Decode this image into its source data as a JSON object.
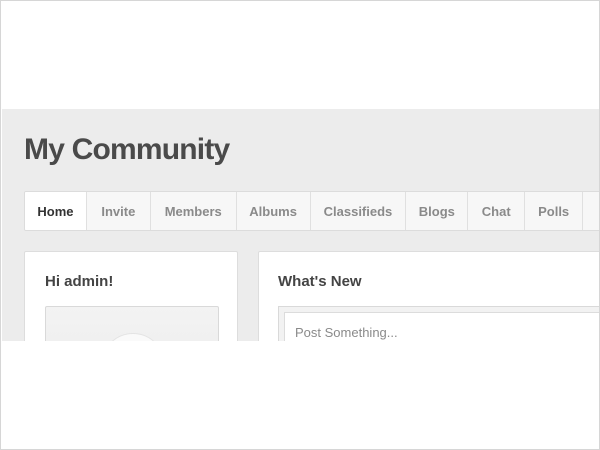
{
  "site": {
    "title": "My Community"
  },
  "nav": {
    "items": [
      {
        "label": "Home",
        "active": true
      },
      {
        "label": "Invite"
      },
      {
        "label": "Members"
      },
      {
        "label": "Albums"
      },
      {
        "label": "Classifieds"
      },
      {
        "label": "Blogs"
      },
      {
        "label": "Chat"
      },
      {
        "label": "Polls"
      },
      {
        "label": ""
      }
    ]
  },
  "sidebar": {
    "greeting": "Hi admin!"
  },
  "feed": {
    "heading": "What's New",
    "post_placeholder": "Post Something..."
  }
}
